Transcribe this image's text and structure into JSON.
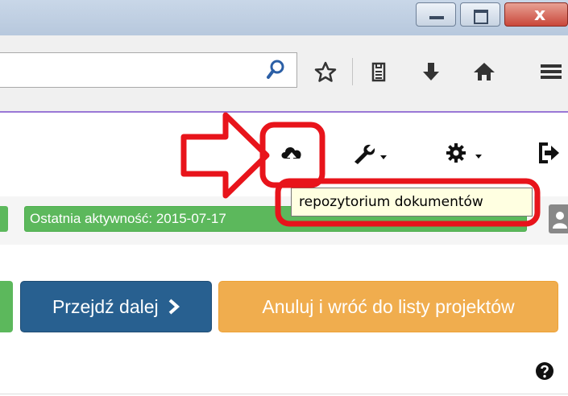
{
  "browser": {
    "icons": [
      "search-icon",
      "star-icon",
      "reading-list-icon",
      "download-icon",
      "home-icon",
      "menu-icon"
    ]
  },
  "app_header": {
    "icons": [
      "repository-upload-icon",
      "wrench-icon",
      "gear-icon",
      "logout-icon"
    ]
  },
  "tooltip": {
    "text": "repozytorium dokumentów"
  },
  "status": {
    "text": "Ostatnia aktywność: 2015-07-17"
  },
  "actions": {
    "next_label": "Przejdź dalej",
    "cancel_label": "Anuluj i wróć do listy projektów"
  },
  "colors": {
    "success": "#5cb85c",
    "primary": "#286090",
    "warning": "#f0ad4e",
    "annotation": "#e8141b"
  }
}
